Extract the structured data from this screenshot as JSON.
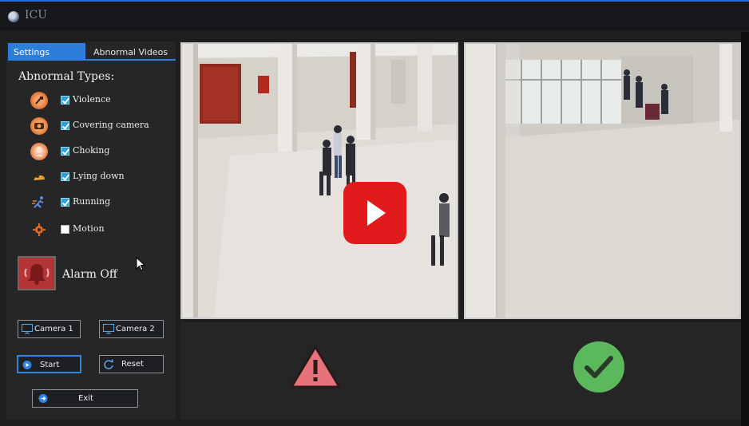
{
  "window": {
    "title": "ICU",
    "title_icon": "globe-icon"
  },
  "tabs": [
    {
      "label": "Settings",
      "active": true
    },
    {
      "label": "Abnormal Videos",
      "active": false
    }
  ],
  "settings": {
    "section_title": "Abnormal Types:",
    "types": [
      {
        "label": "Violence",
        "checked": true,
        "icon": "violence-icon"
      },
      {
        "label": "Covering camera",
        "checked": true,
        "icon": "covering-camera-icon"
      },
      {
        "label": "Choking",
        "checked": true,
        "icon": "choking-icon"
      },
      {
        "label": "Lying down",
        "checked": true,
        "icon": "lying-down-icon"
      },
      {
        "label": "Running",
        "checked": true,
        "icon": "running-icon"
      },
      {
        "label": "Motion",
        "checked": false,
        "icon": "motion-icon"
      }
    ],
    "alarm_label": "Alarm Off"
  },
  "buttons": {
    "camera1": "Camera 1",
    "camera2": "Camera 2",
    "start": "Start",
    "reset": "Reset",
    "exit": "Exit"
  },
  "status": {
    "camera1": "warning",
    "camera2": "ok"
  },
  "colors": {
    "accent": "#2c7ddc",
    "warning": "#e8727a",
    "ok": "#5cb85c",
    "play": "#e11b1b"
  }
}
